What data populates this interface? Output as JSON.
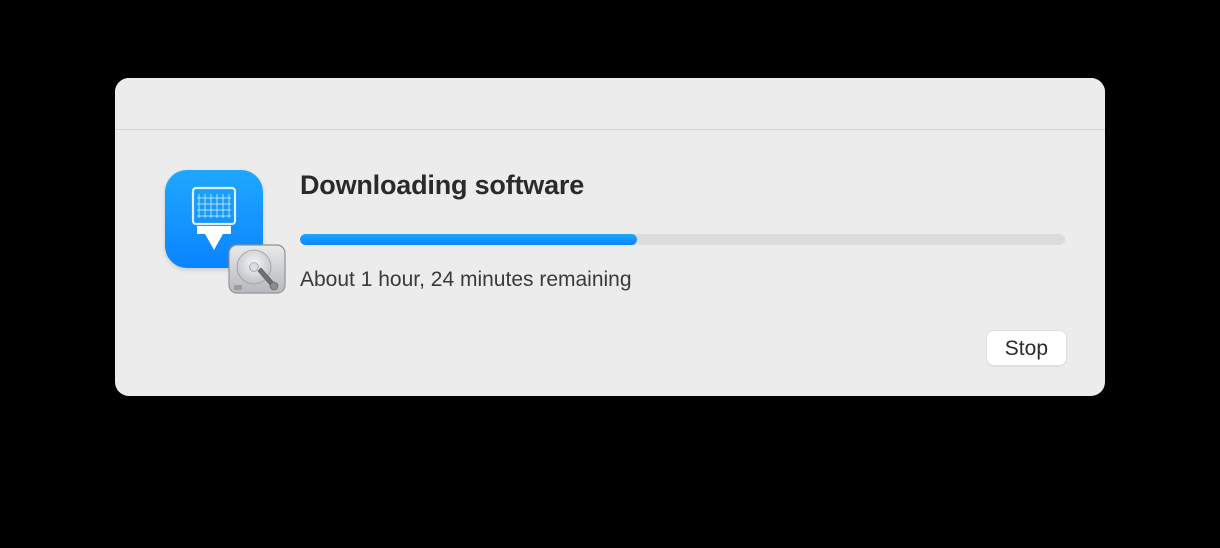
{
  "dialog": {
    "title": "Downloading software",
    "status_text": "About 1 hour, 24 minutes remaining",
    "progress_percent": 44,
    "stop_label": "Stop",
    "icon_name": "download-install-icon",
    "disk_icon_name": "internal-disk-icon"
  },
  "colors": {
    "accent": "#0a84ff",
    "panel_bg": "#ececec",
    "track_bg": "#dcdcdc"
  }
}
